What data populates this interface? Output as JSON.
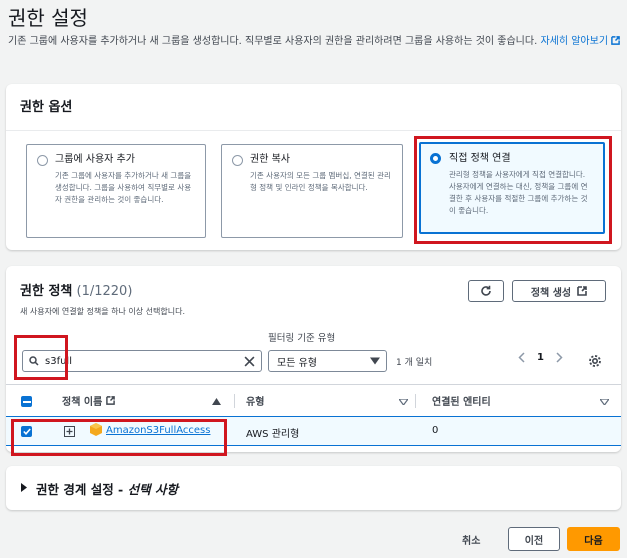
{
  "header": {
    "title": "권한 설정",
    "description": "기존 그룹에 사용자를 추가하거나 새 그룹을 생성합니다. 직무별로 사용자의 권한을 관리하려면 그룹을 사용하는 것이 좋습니다.",
    "learn_more": "자세히 알아보기"
  },
  "permission_options": {
    "heading": "권한 옵션",
    "options": [
      {
        "title": "그룹에 사용자 추가",
        "text": "기존 그룹에 사용자를 추가하거나 새 그룹을 생성합니다. 그룹을 사용하여 직무별로 사용자 권한을 관리하는 것이 좋습니다.",
        "selected": false
      },
      {
        "title": "권한 복사",
        "text": "기존 사용자의 모든 그룹 멤버십, 연결된 관리형 정책 및 인라인 정책을 복사합니다.",
        "selected": false
      },
      {
        "title": "직접 정책 연결",
        "text": "관리형 정책을 사용자에게 직접 연결합니다. 사용자에게 연결하는 대신, 정책을 그룹에 연결한 후 사용자를 적절한 그룹에 추가하는 것이 좋습니다.",
        "selected": true
      }
    ]
  },
  "policies": {
    "heading": "권한 정책",
    "count": "(1/1220)",
    "subtitle": "새 사용자에 연결할 정책을 하나 이상 선택합니다.",
    "create_button": "정책 생성",
    "filter_label": "필터링 기준 유형",
    "search_value": "s3full",
    "filter_select": "모든 유형",
    "match_count": "1 개 일치",
    "page": "1",
    "columns": {
      "name": "정책 이름",
      "type": "유형",
      "entities": "연결된 엔티티"
    },
    "rows": [
      {
        "name": "AmazonS3FullAccess",
        "type": "AWS 관리형",
        "entities": "0",
        "checked": true
      }
    ]
  },
  "boundary": {
    "heading_main": "권한 경계 설정 - ",
    "heading_em": "선택 사항"
  },
  "footer": {
    "cancel": "취소",
    "prev": "이전",
    "next": "다음"
  },
  "colors": {
    "accent": "#0972d3",
    "primary_button": "#ff9900",
    "highlight": "#d0161f"
  }
}
